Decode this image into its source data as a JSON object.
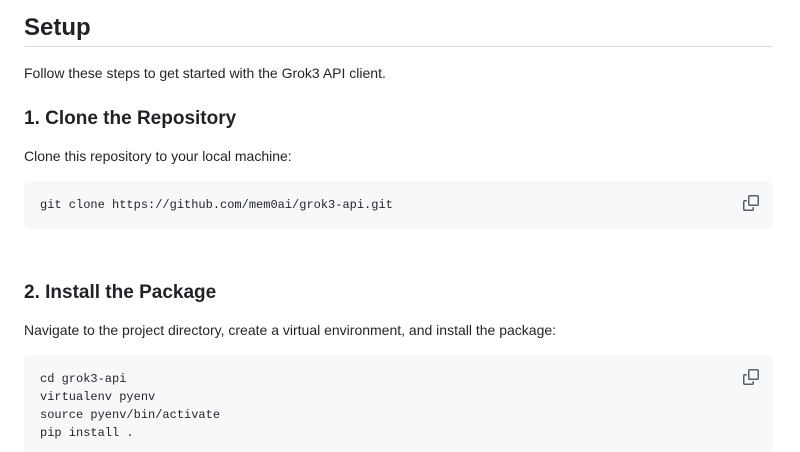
{
  "colors": {
    "page_background": "#ffffff",
    "text": "#1f2328",
    "code_background": "#f6f8fa",
    "divider": "#d8dee4",
    "copy_icon": "#57606a"
  },
  "setup": {
    "title": "Setup",
    "intro": "Follow these steps to get started with the Grok3 API client.",
    "steps": [
      {
        "heading": "1. Clone the Repository",
        "description": "Clone this repository to your local machine:",
        "code": "git clone https://github.com/mem0ai/grok3-api.git"
      },
      {
        "heading": "2. Install the Package",
        "description": "Navigate to the project directory, create a virtual environment, and install the package:",
        "code": "cd grok3-api\nvirtualenv pyenv\nsource pyenv/bin/activate\npip install ."
      }
    ]
  },
  "icons": {
    "copy": "copy-icon (two overlapping squares)"
  }
}
